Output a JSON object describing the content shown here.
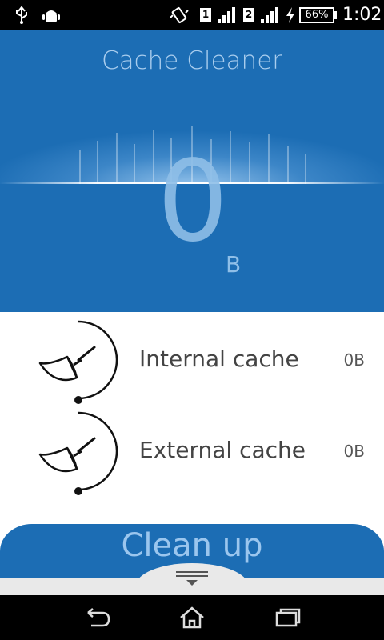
{
  "status_bar": {
    "sim1_label": "1",
    "sim2_label": "2",
    "battery": "66%",
    "time": "1:02",
    "icons": [
      "usb-icon",
      "android-debug-icon",
      "vibrate-icon",
      "sim1-icon",
      "signal-icon",
      "sim2-icon",
      "signal-icon",
      "charging-icon",
      "battery-icon"
    ]
  },
  "header": {
    "title": "Cache Cleaner",
    "total_value": "0",
    "total_unit": "B",
    "accent_color": "#1c6db4"
  },
  "cache_items": [
    {
      "label": "Internal cache",
      "size": "0B",
      "icon": "broom-gauge-icon"
    },
    {
      "label": "External cache",
      "size": "0B",
      "icon": "broom-gauge-icon"
    }
  ],
  "actions": {
    "clean_up_label": "Clean up"
  },
  "nav_bar": {
    "buttons": [
      "back-icon",
      "home-icon",
      "recents-icon"
    ]
  }
}
